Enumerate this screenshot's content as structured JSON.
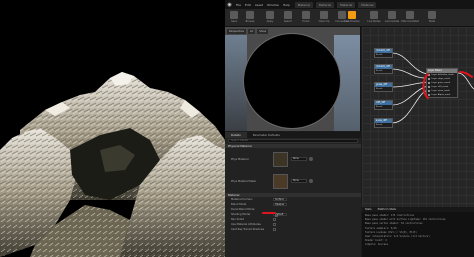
{
  "menubar": {
    "items": [
      "File",
      "Edit",
      "Asset",
      "Window",
      "Help"
    ],
    "tabs": [
      "Material",
      "Material",
      "Material",
      "Material"
    ]
  },
  "toolbar": {
    "buttons": [
      "Save",
      "Browse",
      "Apply",
      "Search",
      "Home",
      "Clean Up",
      "Connectors",
      "Live Preview",
      "Live Nodes",
      "Live Update",
      "Hide Unrelated",
      "Stats"
    ]
  },
  "preview": {
    "tabs": [
      "Perspective",
      "Lit",
      "Show"
    ]
  },
  "details": {
    "tabs": [
      "Details",
      "Parameter Defaults"
    ],
    "search_placeholder": "Search Details",
    "section_physical": "Physical Material",
    "phys_material_label": "Phys Material",
    "phys_material_mask_label": "Phys Material Mask",
    "none_label": "None",
    "section_material": "Material",
    "material_domain_label": "Material Domain",
    "material_domain_value": "Surface",
    "blend_mode_label": "Blend Mode",
    "blend_mode_value": "Opaque",
    "decal_blend_label": "Decal Blend Mode",
    "shading_model_label": "Shading Model",
    "shading_model_value": "Default Lit",
    "two_sided_label": "Two Sided",
    "use_material_attributes_label": "Use Material Attributes",
    "cast_ray_traced_label": "Cast Ray Traced Shadows"
  },
  "graph": {
    "nodes": [
      {
        "title": "Layer Blend",
        "rows": [
          "Layer defaultm_mask",
          "Layer slope_mask",
          "Layer grass_mask",
          "Layer cliff_mask",
          "Layer snow_mask",
          "Layer Alpha_mask"
        ]
      },
      {
        "title": "rocks01_diff",
        "body": "Result"
      },
      {
        "title": "rocks01_diff",
        "body": "Result"
      },
      {
        "title": "grass_diff",
        "body": "Result"
      },
      {
        "title": "cliff_diff",
        "body": "Result"
      },
      {
        "title": "snow_diff",
        "body": "Result"
      }
    ]
  },
  "output": {
    "tabs": [
      "Stats",
      "Platform Stats"
    ],
    "lines": [
      "Base pass shader: 176 instructions",
      "Base pass shader with Surface Lightmap: 191 instructions",
      "Base pass vertex shader: 54 instructions",
      "Texture samplers: 6/16",
      "Texture Lookups (Est.): VS(0), PS(5)",
      "User interpolators: 2/4 Scalars (1/4 Vectors)",
      "Shader Count: 4",
      "Compile: Success"
    ]
  },
  "annotation_color": "#e0141c"
}
